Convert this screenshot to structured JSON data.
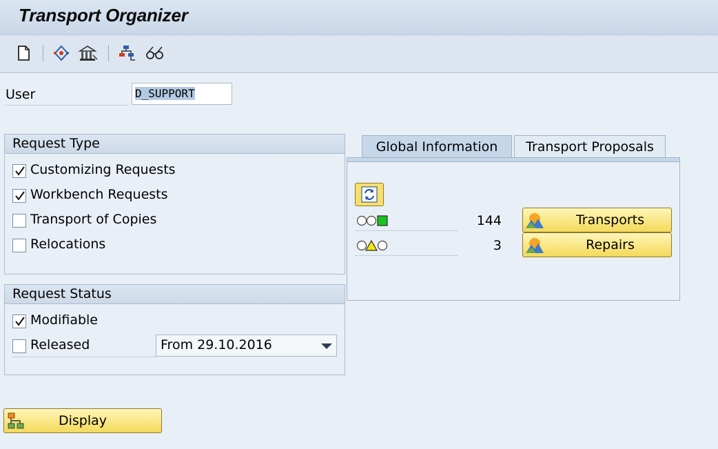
{
  "window": {
    "title": "Transport Organizer"
  },
  "toolbar": {
    "icons": [
      "new-document-icon",
      "request-diamond-icon",
      "building-icon",
      "network-tree-icon",
      "glasses-icon"
    ]
  },
  "user": {
    "label": "User",
    "value": "D_SUPPORT"
  },
  "request_type": {
    "title": "Request Type",
    "items": [
      {
        "label": "Customizing Requests",
        "checked": true
      },
      {
        "label": "Workbench Requests",
        "checked": true
      },
      {
        "label": "Transport of Copies",
        "checked": false
      },
      {
        "label": "Relocations",
        "checked": false
      }
    ]
  },
  "request_status": {
    "title": "Request Status",
    "modifiable": {
      "label": "Modifiable",
      "checked": true
    },
    "released": {
      "label": "Released",
      "checked": false
    },
    "date_filter": "From 29.10.2016"
  },
  "tabs": [
    {
      "label": "Global Information",
      "active": true
    },
    {
      "label": "Transport Proposals",
      "active": false
    }
  ],
  "global_info": {
    "rows": [
      {
        "status": "green",
        "count": "144",
        "button": "Transports"
      },
      {
        "status": "yellow",
        "count": "3",
        "button": "Repairs"
      }
    ]
  },
  "display_button": {
    "label": "Display"
  },
  "colors": {
    "button_yellow": "#f4d95a",
    "header_blue": "#cdd9e7",
    "status_green": "#19c21f",
    "status_yellow": "#f3e514"
  }
}
